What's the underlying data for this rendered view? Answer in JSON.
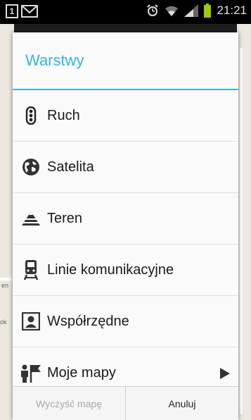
{
  "status_bar": {
    "sim_label": "1",
    "time": "21:21",
    "icons": [
      "sim-icon",
      "gmail-icon",
      "alarm-icon",
      "wifi-icon",
      "signal-icon",
      "battery-icon"
    ]
  },
  "dialog": {
    "title": "Warstwy",
    "items": [
      {
        "label": "Ruch",
        "icon": "traffic-light-icon"
      },
      {
        "label": "Satelita",
        "icon": "globe-icon"
      },
      {
        "label": "Teren",
        "icon": "terrain-icon"
      },
      {
        "label": "Linie komunikacyjne",
        "icon": "train-icon"
      },
      {
        "label": "Współrzędne",
        "icon": "contact-card-icon"
      },
      {
        "label": "Moje mapy",
        "icon": "my-maps-icon",
        "has_submenu": true
      }
    ],
    "buttons": {
      "clear": "Wyczyść mapę",
      "cancel": "Anuluj"
    }
  },
  "colors": {
    "accent": "#33b5e5",
    "status_bar": "#000000",
    "battery": "#99cc00"
  }
}
